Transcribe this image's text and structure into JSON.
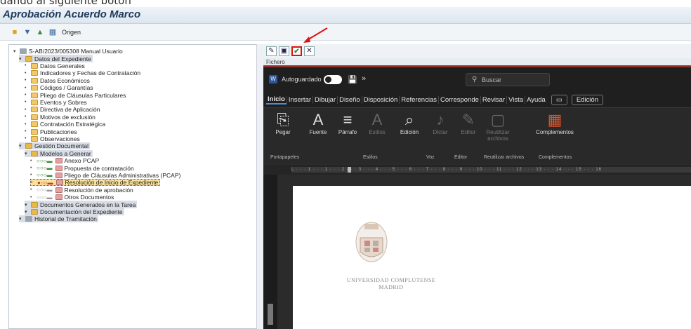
{
  "caption": "dando al siguiente botón",
  "window": {
    "title": "Aprobación Acuerdo Marco"
  },
  "toolbar": {
    "origin_label": "Origen"
  },
  "tree": [
    {
      "label": "S-AB/2023/005308 Manual Usuario",
      "level": 0,
      "icon": "gear-icon",
      "style": ""
    },
    {
      "label": "Datos del Expediente",
      "level": 1,
      "icon": "folder-icon",
      "style": "highlight"
    },
    {
      "label": "Datos Generales",
      "level": 2,
      "icon": "list-icon",
      "style": ""
    },
    {
      "label": "Indicadores y Fechas de Contratación",
      "level": 2,
      "icon": "list-icon",
      "style": ""
    },
    {
      "label": "Datos Económicos",
      "level": 2,
      "icon": "list-icon",
      "style": ""
    },
    {
      "label": "Códigos / Garantías",
      "level": 2,
      "icon": "list-icon",
      "style": ""
    },
    {
      "label": "Pliego de Cláusulas Particulares",
      "level": 2,
      "icon": "list-icon",
      "style": ""
    },
    {
      "label": "Eventos y Sobres",
      "level": 2,
      "icon": "list-icon",
      "style": ""
    },
    {
      "label": "Directiva de Aplicación",
      "level": 2,
      "icon": "list-icon",
      "style": ""
    },
    {
      "label": "Motivos de exclusión",
      "level": 2,
      "icon": "list-icon",
      "style": ""
    },
    {
      "label": "Contratación Estratégica",
      "level": 2,
      "icon": "list-icon",
      "style": ""
    },
    {
      "label": "Publicaciones",
      "level": 2,
      "icon": "list-icon",
      "style": ""
    },
    {
      "label": "Observaciones",
      "level": 2,
      "icon": "list-icon",
      "style": ""
    },
    {
      "label": "Gestión Documental",
      "level": 1,
      "icon": "folder-icon",
      "style": "highlight"
    },
    {
      "label": "Modelos a Generar",
      "level": 2,
      "icon": "folder-icon",
      "style": "highlight"
    },
    {
      "label": "Anexo PCAP",
      "level": 3,
      "icon": "doc-icon",
      "style": "",
      "lights": "green"
    },
    {
      "label": "Propuesta de contratación",
      "level": 3,
      "icon": "doc-icon",
      "style": "",
      "lights": "green"
    },
    {
      "label": "Pliego de Cláusulas Administrativas (PCAP)",
      "level": 3,
      "icon": "doc-icon",
      "style": "",
      "lights": "green"
    },
    {
      "label": "Resolución de Inicio de Expediente",
      "level": 3,
      "icon": "doc-icon",
      "style": "selected",
      "lights": "red"
    },
    {
      "label": "Resolución de aprobación",
      "level": 3,
      "icon": "doc-icon",
      "style": "",
      "lights": "gray"
    },
    {
      "label": "Otros Documentos",
      "level": 3,
      "icon": "doc-icon",
      "style": "",
      "lights": "gray"
    },
    {
      "label": "Documentos Generados en la Tarea",
      "level": 2,
      "icon": "folder-icon",
      "style": "highlight"
    },
    {
      "label": "Documentación del Expediente",
      "level": 2,
      "icon": "folder-icon",
      "style": "highlight"
    },
    {
      "label": "Historial de Tramitación",
      "level": 1,
      "icon": "history-icon",
      "style": "highlight"
    }
  ],
  "sap_viewer": {
    "menu_label": "Fichero"
  },
  "word": {
    "autosave_label": "Autoguardado",
    "search_placeholder": "Buscar",
    "tabs": [
      "Inicio",
      "Insertar",
      "Dibujar",
      "Diseño",
      "Disposición",
      "Referencias",
      "Corresponde",
      "Revisar",
      "Vista",
      "Ayuda"
    ],
    "edit_mode": "Edición",
    "ribbon_groups": [
      {
        "label": "Pegar",
        "icon": "paste-icon",
        "dim": false
      },
      {
        "label": "Fuente",
        "icon": "font-icon",
        "dim": false
      },
      {
        "label": "Párrafo",
        "icon": "paragraph-icon",
        "dim": false
      },
      {
        "label": "Estilos",
        "icon": "styles-icon",
        "dim": true
      },
      {
        "label": "Edición",
        "icon": "find-icon",
        "dim": false
      },
      {
        "label": "Dictar",
        "icon": "mic-icon",
        "dim": true
      },
      {
        "label": "Editor",
        "icon": "editor-icon",
        "dim": true
      },
      {
        "label": "Reutilizar archivos",
        "icon": "reuse-icon",
        "dim": true
      },
      {
        "label": "Complementos",
        "icon": "addins-icon",
        "dim": false
      }
    ],
    "ribbon_footer": [
      "Portapapeles",
      "Estilos",
      "Voz",
      "Editor",
      "Reutilizar archivos",
      "Complementos"
    ],
    "ruler_text": "L · · · 1 · · · 1 · · · 2 · · · 3 · · · 4 · · · 5 · · · 6 · · · 7 · · · 8 · · · 9 · · · 10 · · · 11 · · · 12 · · · 13 · · · 14 · · · 15 · · · 16",
    "document": {
      "university_name": "UNIVERSIDAD COMPLUTENSE",
      "university_city": "MADRID"
    }
  }
}
